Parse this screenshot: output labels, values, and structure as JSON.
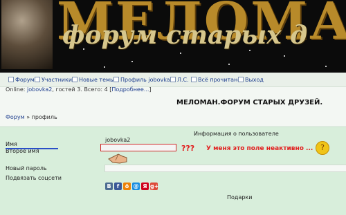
{
  "banner": {
    "title": "МЕЛОМА",
    "subtitle": "форум старых д"
  },
  "nav": {
    "items": [
      {
        "label": "Форум",
        "icon": "forum-icon"
      },
      {
        "label": "Участники",
        "icon": "users-icon"
      },
      {
        "label": "Новые темы",
        "icon": "new-topics-icon"
      },
      {
        "label": "Профиль jobovka2",
        "icon": "profile-icon"
      },
      {
        "label": "Л.С.",
        "icon": "messages-icon"
      },
      {
        "label": "Всё прочитано",
        "icon": "mark-read-icon"
      },
      {
        "label": "Выход",
        "icon": "logout-icon"
      }
    ]
  },
  "online": {
    "prefix": "Online:",
    "user": "jobovka2",
    "rest": ", гостей 3. Всего: 4 [",
    "more": "Подробнее...",
    "close": "]"
  },
  "forum_title": "МЕЛОМАН.ФОРУМ СТАРЫХ ДРУЗЕЙ.",
  "breadcrumb": {
    "home": "Форум",
    "sep": "»",
    "current": "профиль"
  },
  "profile": {
    "header": "Информация о пользователе",
    "name_label": "Имя",
    "name_value": "jobovka2",
    "second_name_label": "Второе имя",
    "password_label": "Новый пароль",
    "social_label": "Подвязать соцсети",
    "gifts_label": "Подарки"
  },
  "annotation": {
    "marks": "???",
    "text": "У меня это поле неактивно ..."
  },
  "social_icons": [
    {
      "name": "vk-icon",
      "glyph": "B",
      "color": "#4c6c91"
    },
    {
      "name": "facebook-icon",
      "glyph": "f",
      "color": "#3b5998"
    },
    {
      "name": "odnoklassniki-icon",
      "glyph": "ö",
      "color": "#ee8208"
    },
    {
      "name": "mail-icon",
      "glyph": "@",
      "color": "#168de2"
    },
    {
      "name": "yandex-icon",
      "glyph": "Я",
      "color": "#d0021b"
    },
    {
      "name": "google-plus-icon",
      "glyph": "g+",
      "color": "#dd4b39"
    }
  ]
}
